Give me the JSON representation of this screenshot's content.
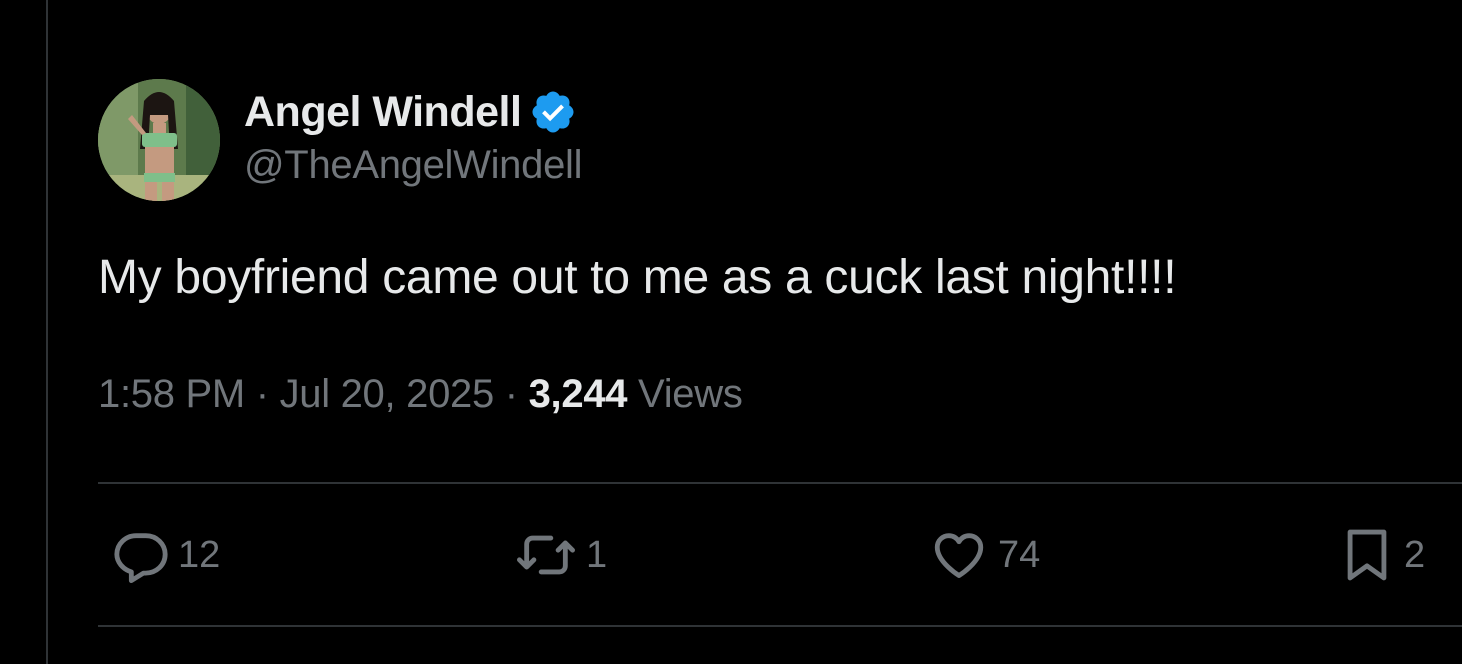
{
  "author": {
    "display_name": "Angel Windell",
    "handle": "@TheAngelWindell",
    "verified_icon": "verified-badge-icon",
    "verified_color": "#1d9bf0"
  },
  "tweet": {
    "text": "My boyfriend came out to me as a cuck last night!!!!",
    "time": "1:58 PM",
    "date": "Jul 20, 2025",
    "separator": "·",
    "views_count": "3,244",
    "views_label": "Views"
  },
  "actions": {
    "reply": {
      "icon": "reply-icon",
      "count": "12"
    },
    "retweet": {
      "icon": "retweet-icon",
      "count": "1"
    },
    "like": {
      "icon": "heart-icon",
      "count": "74"
    },
    "bookmark": {
      "icon": "bookmark-icon",
      "count": "2"
    }
  },
  "colors": {
    "background": "#000000",
    "primary_text": "#e7e9ea",
    "secondary_text": "#71767b",
    "divider": "#2f3336"
  }
}
